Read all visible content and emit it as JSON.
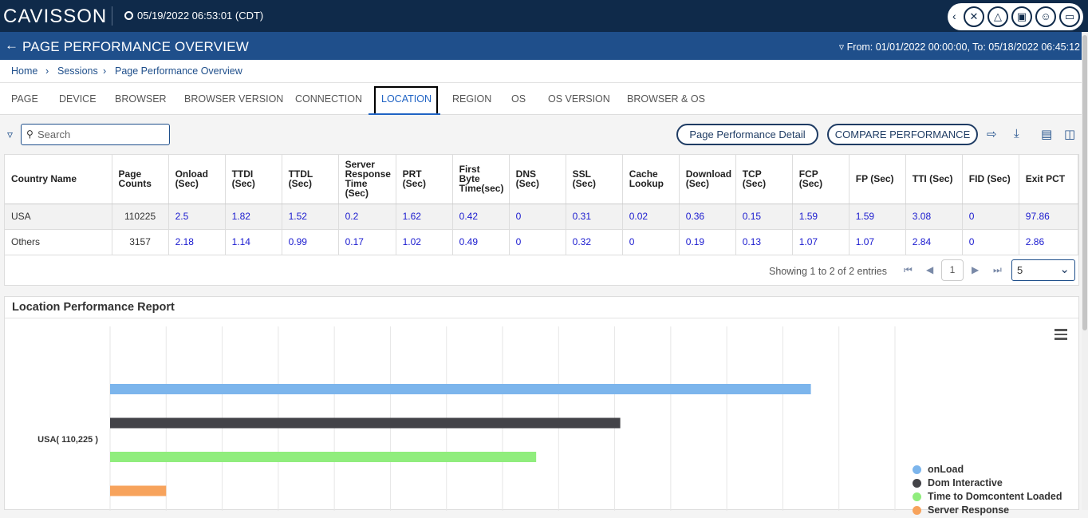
{
  "header": {
    "logo": "CAVISSON",
    "datetime": "05/19/2022 06:53:01 (CDT)",
    "icons": [
      "chevron-left-icon",
      "tools-icon",
      "bell-icon",
      "monitor-icon",
      "user-icon",
      "screen-icon"
    ]
  },
  "titlebar": {
    "title": "PAGE PERFORMANCE OVERVIEW",
    "daterange": "From: 01/01/2022 00:00:00, To: 05/18/2022 06:45:12"
  },
  "breadcrumb": [
    "Home",
    "Sessions",
    "Page Performance Overview"
  ],
  "tabs": [
    {
      "label": "PAGE"
    },
    {
      "label": "DEVICE"
    },
    {
      "label": "BROWSER"
    },
    {
      "label": "BROWSER VERSION"
    },
    {
      "label": "CONNECTION"
    },
    {
      "label": "LOCATION",
      "active": true
    },
    {
      "label": "REGION"
    },
    {
      "label": "OS"
    },
    {
      "label": "OS VERSION"
    },
    {
      "label": "BROWSER & OS"
    }
  ],
  "toolbar": {
    "search_placeholder": "Search",
    "detail_button": "Page Performance Detail",
    "compare_button": "COMPARE PERFORMANCE"
  },
  "table": {
    "columns": [
      "Country Name",
      "Page Counts",
      "Onload (Sec)",
      "TTDI (Sec)",
      "TTDL (Sec)",
      "Server Response Time (Sec)",
      "PRT (Sec)",
      "First Byte Time(sec)",
      "DNS (Sec)",
      "SSL (Sec)",
      "Cache Lookup",
      "Download (Sec)",
      "TCP (Sec)",
      "FCP (Sec)",
      "FP (Sec)",
      "TTI (Sec)",
      "FID (Sec)",
      "Exit PCT"
    ],
    "rows": [
      [
        "USA",
        "110225",
        "2.5",
        "1.82",
        "1.52",
        "0.2",
        "1.62",
        "0.42",
        "0",
        "0.31",
        "0.02",
        "0.36",
        "0.15",
        "1.59",
        "1.59",
        "3.08",
        "0",
        "97.86"
      ],
      [
        "Others",
        "3157",
        "2.18",
        "1.14",
        "0.99",
        "0.17",
        "1.02",
        "0.49",
        "0",
        "0.32",
        "0",
        "0.19",
        "0.13",
        "1.07",
        "1.07",
        "2.84",
        "0",
        "2.86"
      ]
    ]
  },
  "pagination": {
    "showing": "Showing 1 to 2 of 2 entries",
    "page": "1",
    "page_size": "5"
  },
  "report": {
    "title": "Location Performance Report"
  },
  "chart_data": {
    "type": "bar",
    "orientation": "horizontal",
    "categories": [
      "USA( 110,225 )"
    ],
    "series": [
      {
        "name": "onLoad",
        "color": "#7cb5ec",
        "values": [
          2.5
        ]
      },
      {
        "name": "Dom Interactive",
        "color": "#434348",
        "values": [
          1.82
        ]
      },
      {
        "name": "Time to Domcontent Loaded",
        "color": "#90ed7d",
        "values": [
          1.52
        ]
      },
      {
        "name": "Server Response",
        "color": "#f7a35c",
        "values": [
          0.2
        ]
      }
    ],
    "xlim": [
      0,
      2.8
    ],
    "grid": true,
    "legend": "bottom-right"
  }
}
